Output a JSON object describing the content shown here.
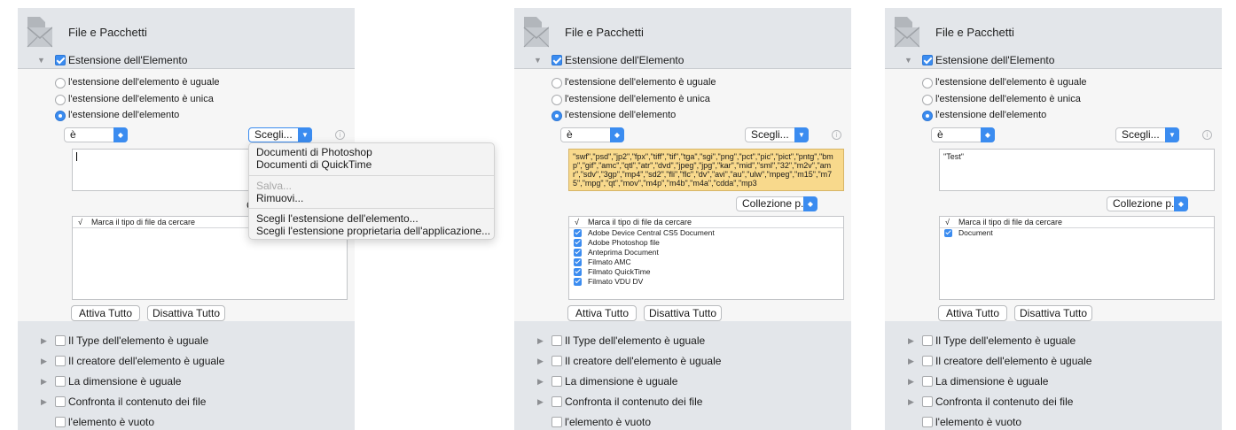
{
  "header_title": "File e Pacchetti",
  "ext_label": "Estensione dell'Elemento",
  "radios": [
    "l'estensione dell'elemento è uguale",
    "l'estensione dell'elemento è unica",
    "l'estensione dell'elemento"
  ],
  "op_value": "è",
  "choose_label": "Scegli...",
  "info": "i",
  "collection_label": "Collezione p...",
  "list_header": "Marca il tipo di file da cercare",
  "check_symbol": "√",
  "activate_all": "Attiva Tutto",
  "deactivate_all": "Disattiva Tutto",
  "criteria": [
    "Il Type dell'elemento è uguale",
    "Il creatore dell'elemento è uguale",
    "La dimensione  è uguale",
    "Confronta il contenuto dei file",
    "l'elemento è vuoto"
  ],
  "collapse_arrow": "▼",
  "expand_arrow": "▶",
  "menu_items": [
    "Documenti di Photoshop",
    "Documenti di QuickTime",
    "Salva...",
    "Rimuovi...",
    "Scegli l'estensione dell'elemento...",
    "Scegli l'estensione proprietaria dell'applicazione..."
  ],
  "menu_peek": "C",
  "ext_text": "\"swf\",\"psd\",\"jp2\",\"fpx\",\"tiff\",\"tif\",\"tga\",\"sgi\",\"png\",\"pct\",\"pic\",\"pict\",\"pntg\",\"bmp\",\"gif\",\"amc\",\"qtl\",\"atr\",\"dvd\",\"jpeg\",\"jpg\",\"kar\",\"mid\",\"sml\",\"32\",\"m2v\",\"amr\",\"sdv\",\"3gp\",\"mp4\",\"sd2\",\"fli\",\"flc\",\"dv\",\"avi\",\"au\",\"ulw\",\"mpeg\",\"m15\",\"m75\",\"mpg\",\"qt\",\"mov\",\"m4p\",\"m4b\",\"m4a\",\"cdda\",\"mp3",
  "file_types_2": [
    "Adobe Device Central CS5 Document",
    "Adobe Photoshop file",
    "Anteprima Document",
    "Filmato AMC",
    "Filmato QuickTime",
    "Filmato VDU DV"
  ],
  "test_text": "\"Test\"",
  "file_types_3": [
    "Document"
  ]
}
